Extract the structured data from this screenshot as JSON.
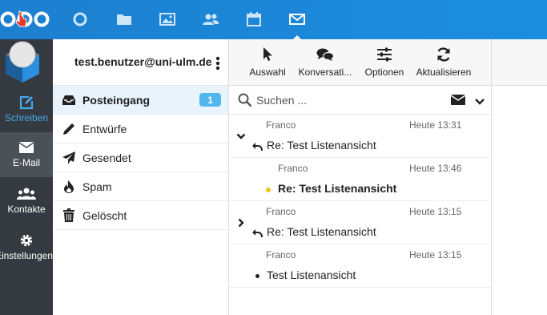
{
  "topbar": {
    "apps": [
      {
        "name": "dashboard",
        "icon": "circle-icon"
      },
      {
        "name": "files",
        "icon": "folder-icon"
      },
      {
        "name": "gallery",
        "icon": "image-icon"
      },
      {
        "name": "contacts",
        "icon": "people-icon"
      },
      {
        "name": "calendar",
        "icon": "calendar-icon"
      },
      {
        "name": "mail",
        "icon": "envelope-icon",
        "active": true
      }
    ],
    "color": "#1b86d8"
  },
  "leftnav": {
    "items": [
      {
        "label": "Schreiben",
        "icon": "pencil-square-icon",
        "color": "#47a9ea"
      },
      {
        "label": "E-Mail",
        "icon": "envelope-icon",
        "active": true
      },
      {
        "label": "Kontakte",
        "icon": "people-icon"
      },
      {
        "label": "Einstellungen",
        "icon": "gear-icon"
      }
    ]
  },
  "account": {
    "email": "test.benutzer@uni-ulm.de"
  },
  "folders": [
    {
      "label": "Posteingang",
      "icon": "inbox-icon",
      "badge": "1",
      "active": true
    },
    {
      "label": "Entwürfe",
      "icon": "pencil-icon"
    },
    {
      "label": "Gesendet",
      "icon": "paper-plane-icon"
    },
    {
      "label": "Spam",
      "icon": "flame-icon"
    },
    {
      "label": "Gelöscht",
      "icon": "trash-icon"
    }
  ],
  "toolbar": {
    "buttons": [
      {
        "label": "Auswahl",
        "icon": "cursor-icon"
      },
      {
        "label": "Konversati...",
        "icon": "chat-bubbles-icon"
      },
      {
        "label": "Optionen",
        "icon": "sliders-icon"
      },
      {
        "label": "Aktualisieren",
        "icon": "refresh-icon"
      }
    ]
  },
  "search": {
    "placeholder": "Suchen ..."
  },
  "messages": [
    {
      "from": "Franco",
      "time": "Heute 13:31",
      "subject": "Re: Test Listenansicht",
      "thread_toggle": "expanded",
      "replied": true
    },
    {
      "from": "Franco",
      "time": "Heute 13:46",
      "subject": "Re: Test Listenansicht",
      "unread": true,
      "child": true,
      "dot_color": "#f0c419"
    },
    {
      "from": "Franco",
      "time": "Heute 13:15",
      "subject": "Re: Test Listenansicht",
      "thread_toggle": "collapsed",
      "replied": true
    },
    {
      "from": "Franco",
      "time": "Heute 13:15",
      "subject": "Test Listenansicht",
      "dot_color": "#222222"
    }
  ]
}
